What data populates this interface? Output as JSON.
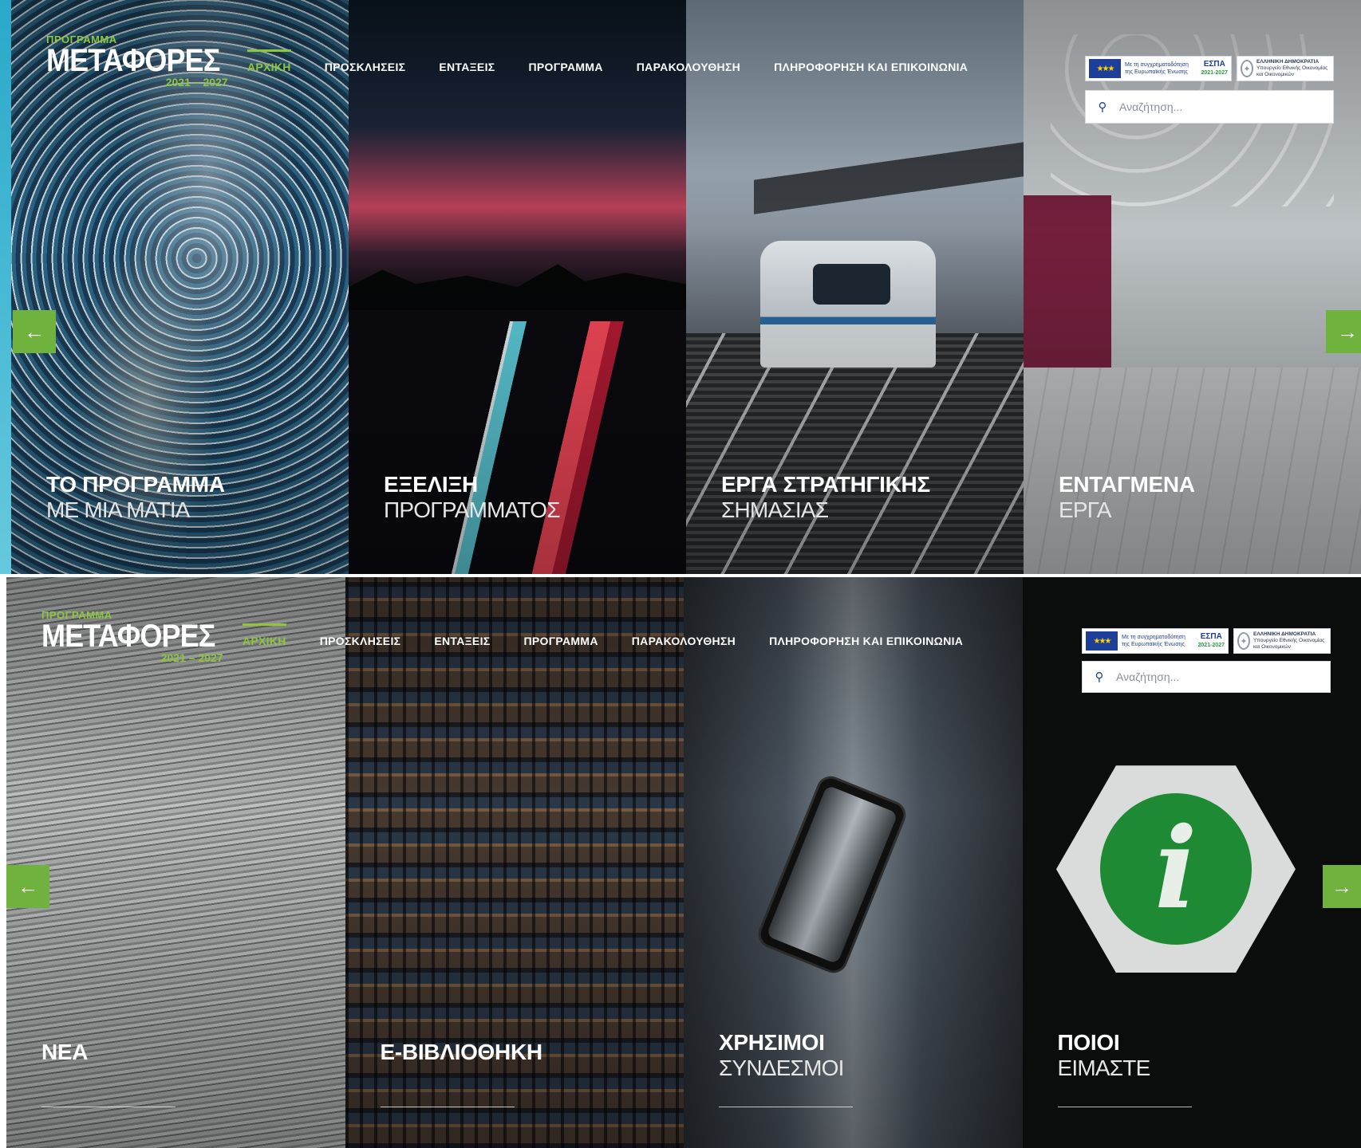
{
  "screens": [
    {
      "logo": {
        "top": "ΠΡΟΓΡΑΜΜΑ",
        "main": "ΜΕΤΑΦΟΡΕΣ",
        "years": "2021 – 2027"
      },
      "nav": [
        "ΑΡΧΙΚΗ",
        "ΠΡΟΣΚΛΗΣΕΙΣ",
        "ΕΝΤΑΞΕΙΣ",
        "ΠΡΟΓΡΑΜΜΑ",
        "ΠΑΡΑΚΟΛΟΥΘΗΣΗ",
        "ΠΛΗΡΟΦΟΡΗΣΗ ΚΑΙ ΕΠΙΚΟΙΝΩΝΙΑ"
      ],
      "active_nav": "ΑΡΧΙΚΗ",
      "search_placeholder": "Αναζήτηση...",
      "panels": [
        {
          "bold": "ΤΟ ΠΡΟΓΡΑΜΜΑ",
          "light": "ΜΕ ΜΙΑ ΜΑΤΙΑ",
          "theme": "sea"
        },
        {
          "bold": "ΕΞΕΛΙΞΗ",
          "light": "ΠΡΟΓΡΑΜΜΑΤΟΣ",
          "theme": "highway"
        },
        {
          "bold": "ΕΡΓΑ ΣΤΡΑΤΗΓΙΚΗΣ",
          "light": "ΣΗΜΑΣΙΑΣ",
          "theme": "train"
        },
        {
          "bold": "ΕΝΤΑΓΜΕΝΑ",
          "light": "ΕΡΓΑ",
          "theme": "metro"
        }
      ]
    },
    {
      "logo": {
        "top": "ΠΡΟΓΡΑΜΜΑ",
        "main": "ΜΕΤΑΦΟΡΕΣ",
        "years": "2021 – 2027"
      },
      "nav": [
        "ΑΡΧΙΚΗ",
        "ΠΡΟΣΚΛΗΣΕΙΣ",
        "ΕΝΤΑΞΕΙΣ",
        "ΠΡΟΓΡΑΜΜΑ",
        "ΠΑΡΑΚΟΛΟΥΘΗΣΗ",
        "ΠΛΗΡΟΦΟΡΗΣΗ ΚΑΙ ΕΠΙΚΟΙΝΩΝΙΑ"
      ],
      "active_nav": "ΑΡΧΙΚΗ",
      "search_placeholder": "Αναζήτηση...",
      "panels": [
        {
          "bold": "ΝΕΑ",
          "light": "",
          "theme": "paper"
        },
        {
          "bold": "Ε-ΒΙΒΛΙΟΘΗΚΗ",
          "light": "",
          "theme": "library"
        },
        {
          "bold": "ΧΡΗΣΙΜΟΙ",
          "light": "ΣΥΝΔΕΣΜΟΙ",
          "theme": "links"
        },
        {
          "bold": "ΠΟΙΟΙ",
          "light": "ΕΙΜΑΣΤΕ",
          "theme": "who"
        }
      ]
    }
  ],
  "badges": {
    "eu_text": "Με τη συγχρηματοδότηση της Ευρωπαϊκής Ένωσης",
    "espa": "ΕΣΠΑ",
    "espa_years": "2021-2027",
    "gr_title": "ΕΛΛΗΝΙΚΗ ΔΗΜΟΚΡΑΤΙΑ",
    "gr_sub": "Υπουργείο Εθνικής Οικονομίας και Οικονομικών"
  },
  "arrows": {
    "prev": "←",
    "next": "→"
  },
  "icons": {
    "search": "search-icon",
    "prev": "arrow-left-icon",
    "next": "arrow-right-icon",
    "info": "info-icon"
  },
  "colors": {
    "accent": "#8dc63f",
    "arrow_bg": "#6fb33e",
    "eu_blue": "#1d3f9a",
    "info_green": "#1f8a34"
  }
}
